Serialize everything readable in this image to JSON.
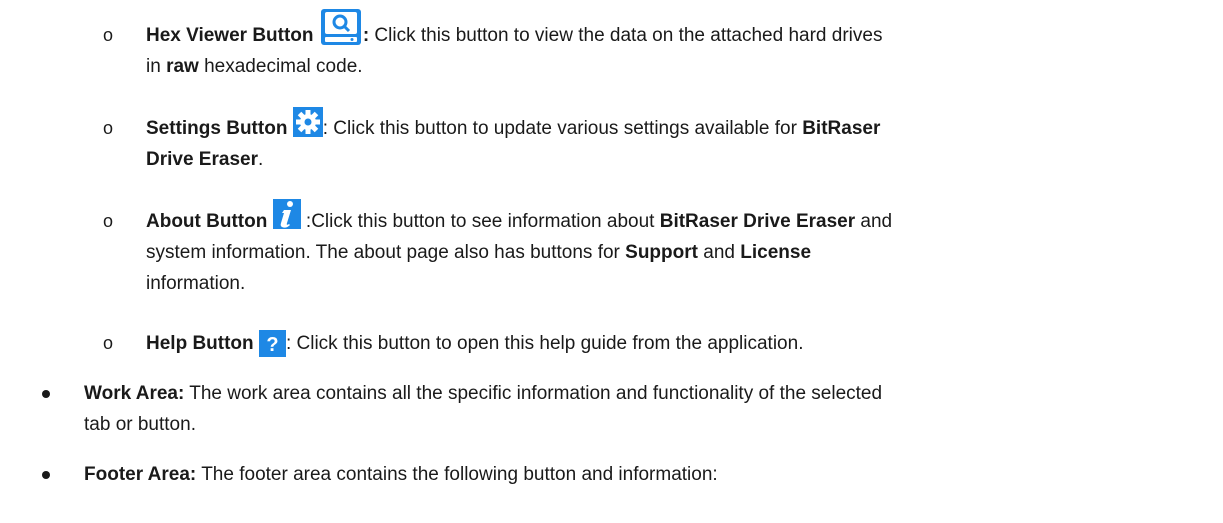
{
  "items": [
    {
      "title": "Hex Viewer Button",
      "icon": "hex-viewer-icon",
      "sep": ":",
      "line1": " Click this button to view the data on the attached hard drives",
      "line2_pre": "in ",
      "line2_bold": "raw",
      "line2_post": " hexadecimal code."
    },
    {
      "title": "Settings Button",
      "icon": "gear-icon",
      "sep": ":",
      "line1": " Click this button to update various settings available for ",
      "line1_bold": "BitRaser",
      "line2_bold": "Drive Eraser",
      "line2_post": "."
    },
    {
      "title": "About Button",
      "icon": "info-icon",
      "sep": " :",
      "line1": "Click this button to see information about ",
      "line1_bold": "BitRaser Drive Eraser",
      "line1_post": " and",
      "line2_pre": "system information. The about page also has buttons for ",
      "line2_bold": "Support",
      "line2_mid": " and ",
      "line2_bold2": "License",
      "line3": "information."
    },
    {
      "title": "Help Button",
      "icon": "help-icon",
      "sep": ":",
      "line1": " Click this button to open this help guide from the application."
    }
  ],
  "main_items": [
    {
      "title": "Work Area:",
      "line1": " The work area contains all the specific information and functionality of the selected",
      "line2": "tab or button."
    },
    {
      "title": "Footer Area:",
      "line1": " The footer area contains the following button and information:"
    }
  ],
  "colors": {
    "icon_blue": "#1E88E5",
    "text": "#1a1a1a"
  }
}
